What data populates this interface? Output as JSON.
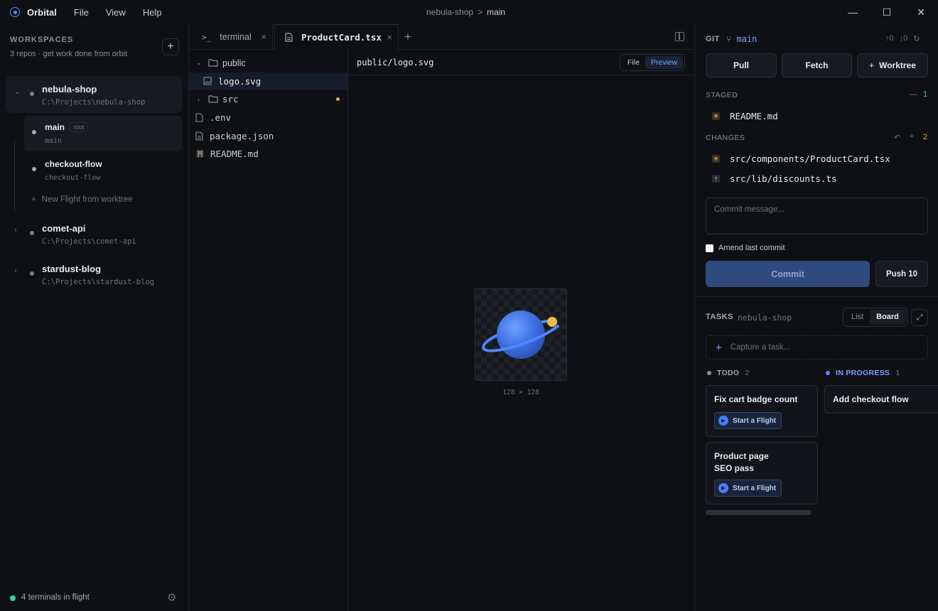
{
  "titlebar": {
    "app_name": "Orbital",
    "menu": [
      "File",
      "View",
      "Help"
    ],
    "breadcrumb_repo": "nebula-shop",
    "breadcrumb_sep": ">",
    "breadcrumb_branch": "main"
  },
  "sidebar": {
    "title": "WORKSPACES",
    "subtitle": "3 repos · get work done from orbit",
    "repos": [
      {
        "name": "nebula-shop",
        "path": "C:\\Projects\\nebula-shop"
      },
      {
        "name": "comet-api",
        "path": "C:\\Projects\\comet-api"
      },
      {
        "name": "stardust-blog",
        "path": "C:\\Projects\\stardust-blog"
      }
    ],
    "branches": [
      {
        "name": "main",
        "sub": "main",
        "badge": "root"
      },
      {
        "name": "checkout-flow",
        "sub": "checkout-flow"
      }
    ],
    "new_flight": "New Flight from worktree",
    "footer": "4 terminals in flight"
  },
  "tabs": [
    {
      "label": "terminal",
      "icon": ">_"
    },
    {
      "label": "ProductCard.tsx",
      "icon": "file"
    }
  ],
  "filetree": [
    {
      "name": "public"
    },
    {
      "name": "logo.svg"
    },
    {
      "name": "src"
    },
    {
      "name": ".env"
    },
    {
      "name": "package.json"
    },
    {
      "name": "README.md",
      "badge": "M"
    }
  ],
  "preview": {
    "path": "public/logo.svg",
    "modes": [
      "File",
      "Preview"
    ],
    "active_mode": "Preview",
    "dims": "128 × 128"
  },
  "git": {
    "title": "GIT",
    "branch": "main",
    "ahead": "↑0",
    "behind": "↓0",
    "buttons": {
      "pull": "Pull",
      "fetch": "Fetch",
      "worktree": "Worktree"
    },
    "staged_label": "STAGED",
    "staged_count": "1",
    "staged": [
      {
        "badge": "M",
        "file": "README.md"
      }
    ],
    "changes_label": "CHANGES",
    "changes_count": "2",
    "changes": [
      {
        "badge": "M",
        "file": "src/components/ProductCard.tsx"
      },
      {
        "badge": "?",
        "file": "src/lib/discounts.ts"
      }
    ],
    "commit_placeholder": "Commit message...",
    "amend_label": "Amend last commit",
    "commit_label": "Commit",
    "push_label": "Push 10"
  },
  "tasks": {
    "title": "TASKS",
    "repo": "nebula-shop",
    "views": [
      "List",
      "Board"
    ],
    "active_view": "Board",
    "capture_placeholder": "Capture a task...",
    "columns": [
      {
        "name": "TODO",
        "count": "2",
        "color": "#8a8f99"
      },
      {
        "name": "IN PROGRESS",
        "count": "1",
        "color": "#5b8cff"
      }
    ],
    "cards": {
      "todo1": "Fix cart badge count",
      "todo2": "Product page SEO pass",
      "inprogress1": "Add checkout flow"
    },
    "start_flight": "Start a Flight"
  },
  "colors": {
    "accent": "#5b8cff",
    "status_online": "#34d399",
    "modified": "#e3b341"
  }
}
